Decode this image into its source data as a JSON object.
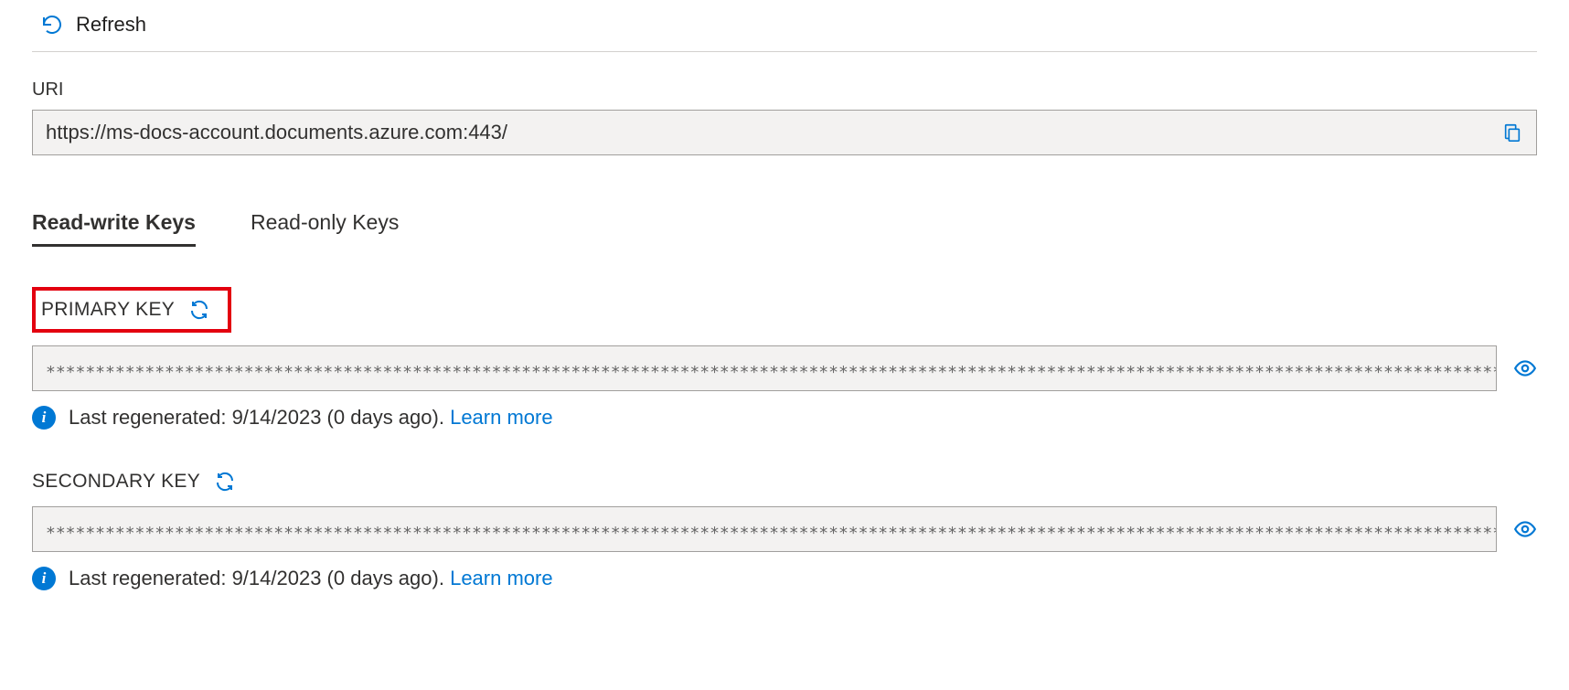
{
  "toolbar": {
    "refresh_label": "Refresh"
  },
  "uri": {
    "label": "URI",
    "value": "https://ms-docs-account.documents.azure.com:443/"
  },
  "tabs": {
    "rw": "Read-write Keys",
    "ro": "Read-only Keys"
  },
  "primary": {
    "label": "PRIMARY KEY",
    "masked": "******************************************************************************************************************************************************************",
    "info_text": "Last regenerated: 9/14/2023 (0 days ago). ",
    "learn_more": "Learn more"
  },
  "secondary": {
    "label": "SECONDARY KEY",
    "masked": "******************************************************************************************************************************************************************",
    "info_text": "Last regenerated: 9/14/2023 (0 days ago). ",
    "learn_more": "Learn more"
  }
}
